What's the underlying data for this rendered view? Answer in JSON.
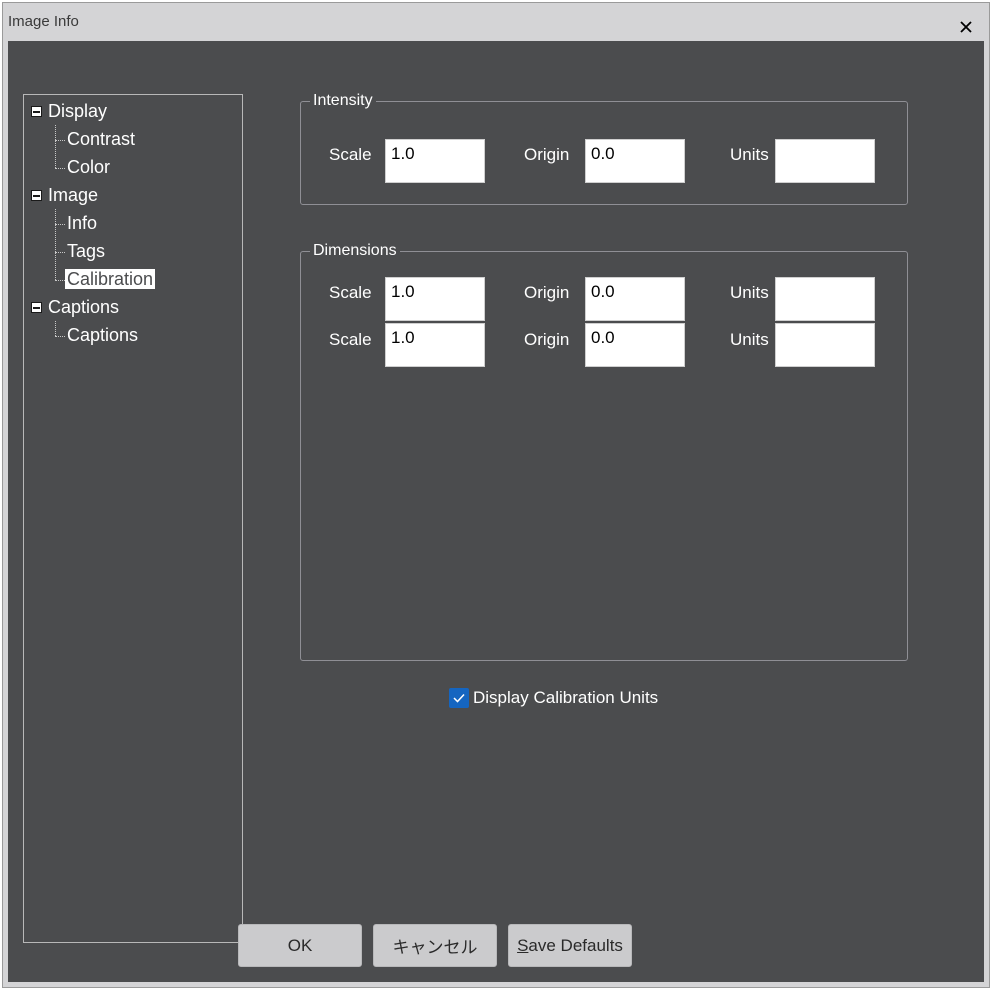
{
  "window": {
    "title": "Image Info"
  },
  "tree": {
    "items": [
      {
        "label": "Display",
        "level": 0,
        "expanded": true
      },
      {
        "label": "Contrast",
        "level": 1
      },
      {
        "label": "Color",
        "level": 1
      },
      {
        "label": "Image",
        "level": 0,
        "expanded": true
      },
      {
        "label": "Info",
        "level": 1
      },
      {
        "label": "Tags",
        "level": 1
      },
      {
        "label": "Calibration",
        "level": 1,
        "selected": true
      },
      {
        "label": "Captions",
        "level": 0,
        "expanded": true
      },
      {
        "label": "Captions",
        "level": 1
      }
    ]
  },
  "intensity": {
    "title": "Intensity",
    "scale_label": "Scale",
    "scale": "1.0",
    "origin_label": "Origin",
    "origin": "0.0",
    "units_label": "Units",
    "units": ""
  },
  "dimensions": {
    "title": "Dimensions",
    "rows": [
      {
        "scale_label": "Scale",
        "scale": "1.0",
        "origin_label": "Origin",
        "origin": "0.0",
        "units_label": "Units",
        "units": ""
      },
      {
        "scale_label": "Scale",
        "scale": "1.0",
        "origin_label": "Origin",
        "origin": "0.0",
        "units_label": "Units",
        "units": ""
      }
    ]
  },
  "display_units": {
    "label": "Display Calibration Units",
    "checked": true
  },
  "buttons": {
    "ok": "OK",
    "cancel": "キャンセル",
    "save_defaults_mnemonic": "S",
    "save_defaults_rest": "ave Defaults"
  },
  "colors": {
    "background": "#4b4c4e",
    "titlebar": "#d4d4d6",
    "checkbox": "#1565c0",
    "button": "#cbcbcd"
  },
  "icons": {
    "close": "close-icon",
    "collapse": "tree-collapse-icon",
    "check": "check-icon"
  }
}
